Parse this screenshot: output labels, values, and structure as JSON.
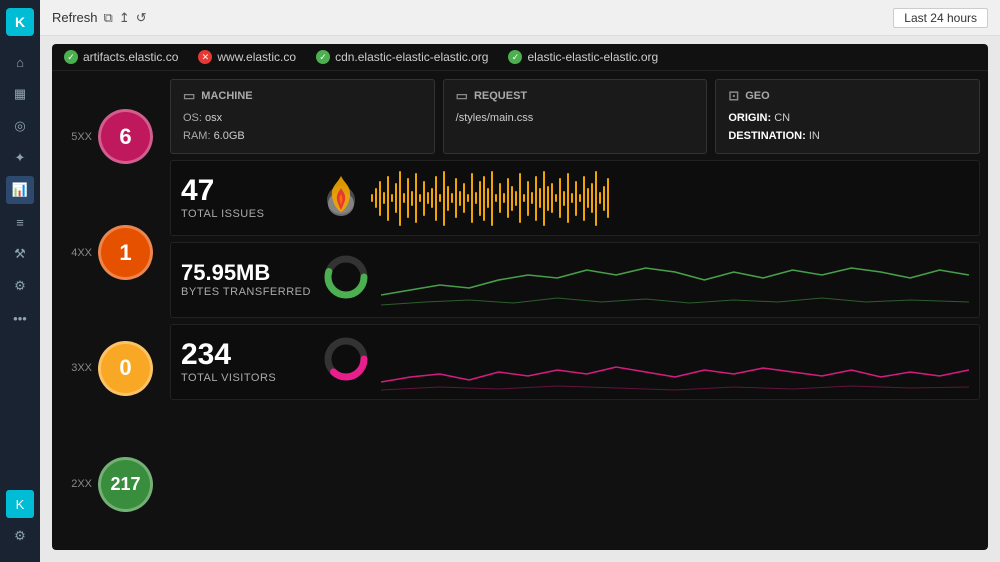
{
  "sidebar": {
    "logo": "K",
    "icons": [
      {
        "name": "home-icon",
        "symbol": "⌂",
        "active": false
      },
      {
        "name": "grid-icon",
        "symbol": "▦",
        "active": false
      },
      {
        "name": "target-icon",
        "symbol": "◎",
        "active": false
      },
      {
        "name": "shield-icon",
        "symbol": "⊕",
        "active": false
      },
      {
        "name": "chart-icon",
        "symbol": "⬡",
        "active": true
      },
      {
        "name": "filter-icon",
        "symbol": "≡",
        "active": false
      },
      {
        "name": "wrench-icon",
        "symbol": "⚒",
        "active": false
      },
      {
        "name": "gear-icon",
        "symbol": "⚙",
        "active": false
      },
      {
        "name": "dots-icon",
        "symbol": "⋯",
        "active": false
      }
    ],
    "bottom_icons": [
      {
        "name": "box-icon",
        "symbol": "⬛"
      },
      {
        "name": "settings-icon",
        "symbol": "⚙"
      }
    ]
  },
  "topbar": {
    "refresh_label": "Refresh",
    "time_filter": "Last 24 hours"
  },
  "status_bar": {
    "items": [
      {
        "url": "artifacts.elastic.co",
        "status": "ok"
      },
      {
        "url": "www.elastic.co",
        "status": "error"
      },
      {
        "url": "cdn.elastic-elastic-elastic.org",
        "status": "ok"
      },
      {
        "url": "elastic-elastic-elastic.org",
        "status": "ok"
      }
    ]
  },
  "circles": [
    {
      "label": "5XX",
      "value": "6",
      "class": "circle-5xx"
    },
    {
      "label": "4XX",
      "value": "1",
      "class": "circle-4xx"
    },
    {
      "label": "3XX",
      "value": "0",
      "class": "circle-3xx"
    },
    {
      "label": "2XX",
      "value": "217",
      "class": "circle-2xx"
    }
  ],
  "info_cards": [
    {
      "name": "machine",
      "icon": "💻",
      "title": "MACHINE",
      "lines": [
        {
          "key": "OS:",
          "value": "osx"
        },
        {
          "key": "RAM:",
          "value": "6.0GB"
        }
      ]
    },
    {
      "name": "request",
      "icon": "💬",
      "title": "REQUEST",
      "lines": [
        {
          "key": "",
          "value": "/styles/main.css"
        }
      ]
    },
    {
      "name": "geo",
      "icon": "📷",
      "title": "GEO",
      "lines": [
        {
          "key": "ORIGIN:",
          "value": "CN"
        },
        {
          "key": "DESTINATION:",
          "value": "IN"
        }
      ]
    }
  ],
  "metrics": [
    {
      "name": "total-issues",
      "value": "47",
      "label": "TOTAL ISSUES",
      "icon_type": "flame",
      "chart_type": "barcode"
    },
    {
      "name": "bytes-transferred",
      "value": "75.95MB",
      "label": "BYTES TRANSFERRED",
      "icon_type": "donut-green",
      "chart_type": "line-green"
    },
    {
      "name": "total-visitors",
      "value": "234",
      "label": "TOTAL VISITORS",
      "icon_type": "donut-pink",
      "chart_type": "line-pink"
    }
  ],
  "colors": {
    "sidebar_bg": "#1a2332",
    "panel_bg": "#111111",
    "metric_bg": "#0d0d0d",
    "accent_cyan": "#00bcd4",
    "bar_orange": "#f0a500",
    "line_green": "#4caf50",
    "line_pink": "#e91e8c",
    "circle_red": "#c0185c",
    "circle_orange": "#e65100",
    "circle_yellow": "#f9a825",
    "circle_green": "#388e3c"
  }
}
